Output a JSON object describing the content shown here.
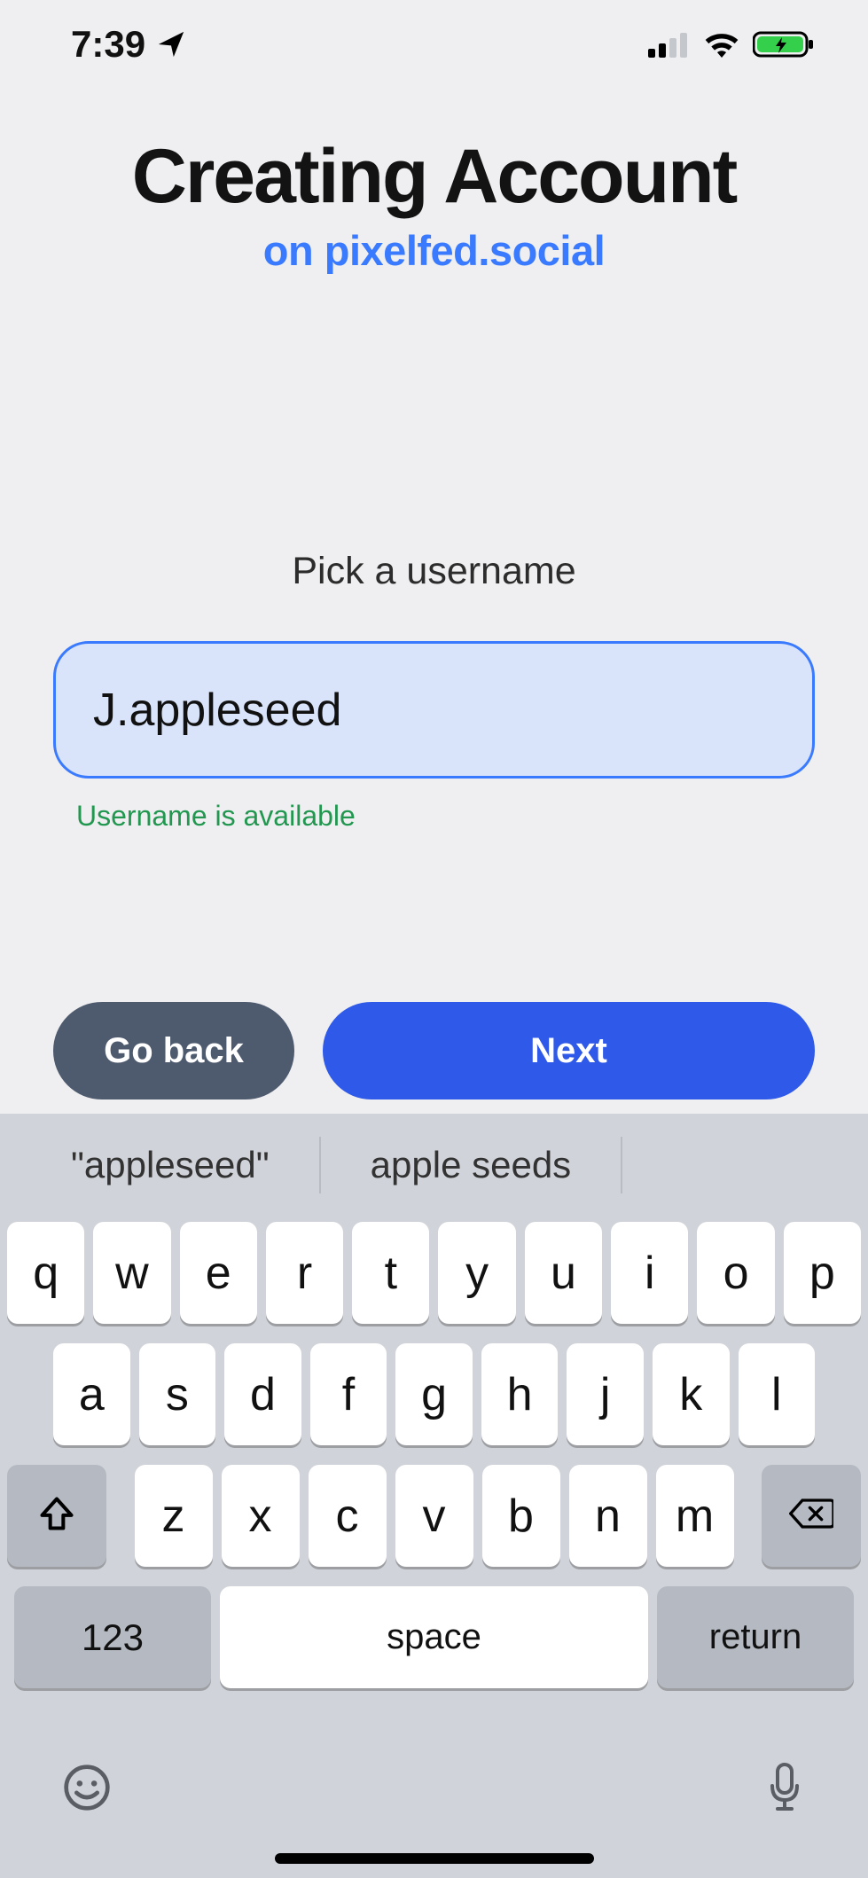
{
  "status": {
    "time": "7:39"
  },
  "header": {
    "title": "Creating Account",
    "subtitle": "on pixelfed.social"
  },
  "form": {
    "prompt": "Pick a username",
    "username_value": "J.appleseed",
    "availability_msg": "Username is available"
  },
  "buttons": {
    "back": "Go back",
    "next": "Next"
  },
  "keyboard": {
    "suggestions": [
      "\"appleseed\"",
      "apple seeds"
    ],
    "row1": [
      "q",
      "w",
      "e",
      "r",
      "t",
      "y",
      "u",
      "i",
      "o",
      "p"
    ],
    "row2": [
      "a",
      "s",
      "d",
      "f",
      "g",
      "h",
      "j",
      "k",
      "l"
    ],
    "row3": [
      "z",
      "x",
      "c",
      "v",
      "b",
      "n",
      "m"
    ],
    "numkey": "123",
    "space": "space",
    "return": "return"
  }
}
